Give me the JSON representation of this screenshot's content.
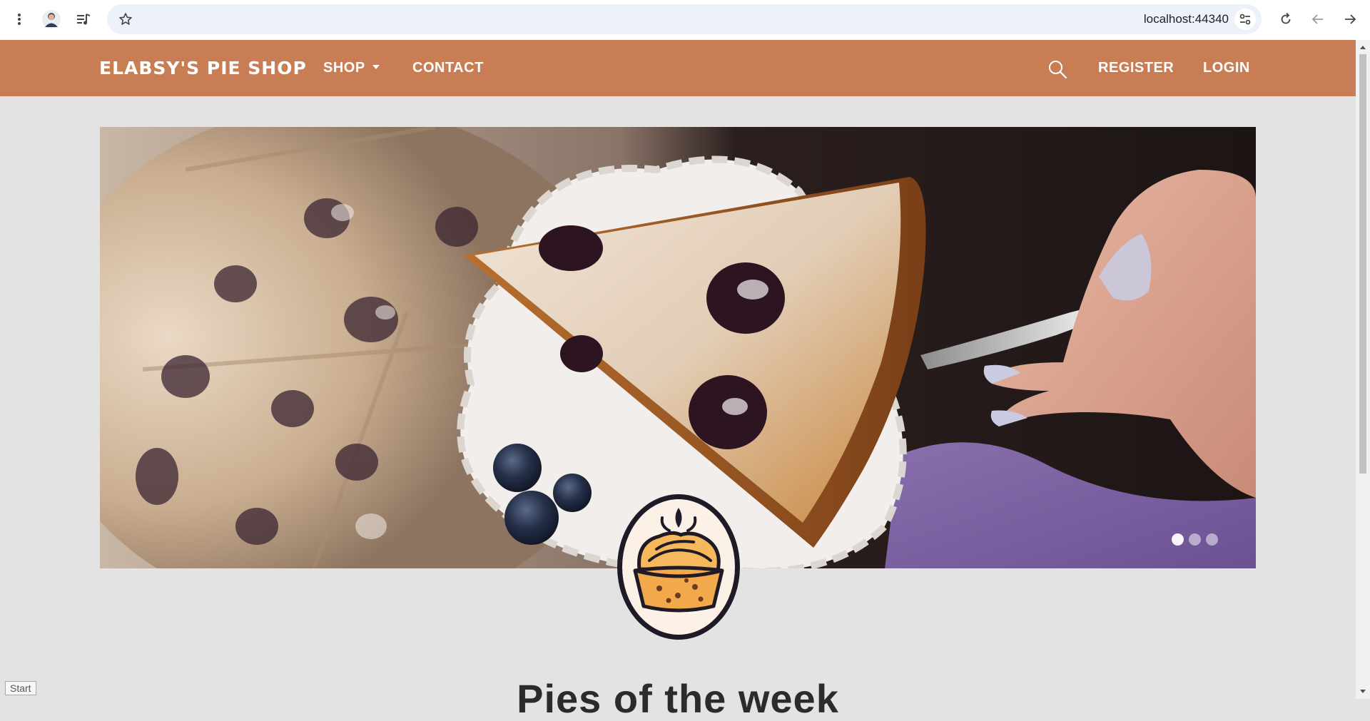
{
  "browser": {
    "url": "localhost:44340"
  },
  "navbar": {
    "brand": "ELABSY'S PIE SHOP",
    "shop_label": "SHOP",
    "contact_label": "CONTACT",
    "register_label": "REGISTER",
    "login_label": "LOGIN",
    "color": "#c97d54"
  },
  "carousel": {
    "slide_count": 3,
    "active_index": 0
  },
  "main": {
    "section_title": "Pies of the week"
  },
  "status": {
    "tooltip": "Start"
  },
  "icons": {
    "menu": "kebab-menu-icon",
    "profile": "profile-avatar",
    "media": "media-controls-icon",
    "bookmark": "star-icon",
    "site_settings": "tune-icon",
    "reload": "reload-icon",
    "back": "back-arrow-icon",
    "forward": "forward-arrow-icon",
    "search": "search-icon"
  }
}
